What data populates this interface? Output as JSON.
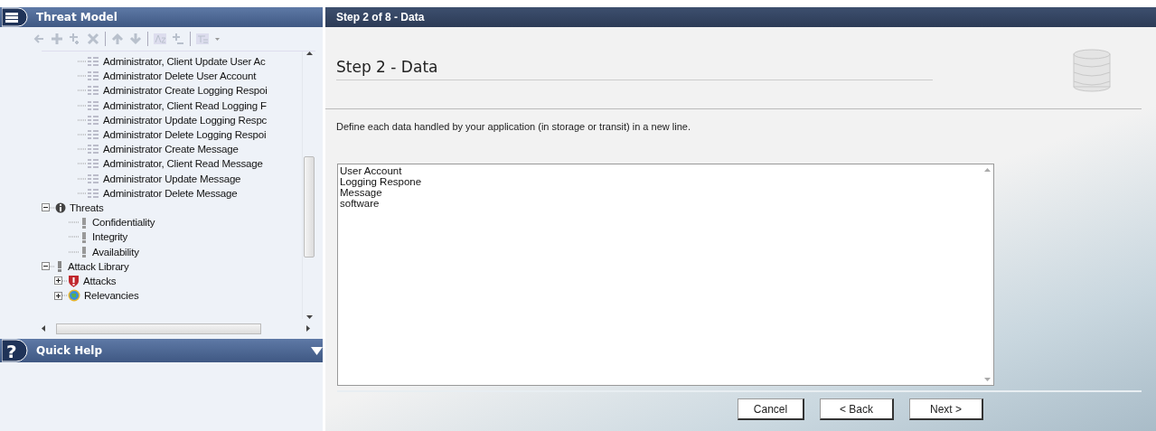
{
  "left_panel": {
    "title": "Threat Model",
    "tree": [
      {
        "label": "Administrator, Client Update User Ac",
        "kind": "task"
      },
      {
        "label": "Administrator Delete User Account",
        "kind": "task"
      },
      {
        "label": "Administrator Create Logging Respoi",
        "kind": "task"
      },
      {
        "label": "Administrator, Client Read Logging F",
        "kind": "task"
      },
      {
        "label": "Administrator Update Logging Respc",
        "kind": "task"
      },
      {
        "label": "Administrator Delete Logging Respoi",
        "kind": "task"
      },
      {
        "label": "Administrator Create Message",
        "kind": "task"
      },
      {
        "label": "Administrator, Client Read Message",
        "kind": "task"
      },
      {
        "label": "Administrator Update Message",
        "kind": "task"
      },
      {
        "label": "Administrator Delete Message",
        "kind": "task"
      },
      {
        "label": "Threats",
        "kind": "threats",
        "expanded": true,
        "children": [
          {
            "label": "Confidentiality",
            "kind": "threat"
          },
          {
            "label": "Integrity",
            "kind": "threat"
          },
          {
            "label": "Availability",
            "kind": "threat"
          }
        ]
      },
      {
        "label": "Attack Library",
        "kind": "library",
        "expanded": true,
        "children": [
          {
            "label": "Attacks",
            "kind": "attacks",
            "expanded": false
          },
          {
            "label": "Relevancies",
            "kind": "relevancies",
            "expanded": false
          }
        ]
      }
    ]
  },
  "quick_help": {
    "icon": "?",
    "title": "Quick Help"
  },
  "wizard": {
    "header": "Step 2 of 8 - Data",
    "title": "Step 2 - Data",
    "instruction": "Define each data handled by your application (in storage or transit) in a new line.",
    "data_lines": [
      "User Account",
      "Logging Respone",
      "Message",
      "software"
    ],
    "buttons": [
      "Cancel",
      "< Back",
      "Next >"
    ]
  }
}
